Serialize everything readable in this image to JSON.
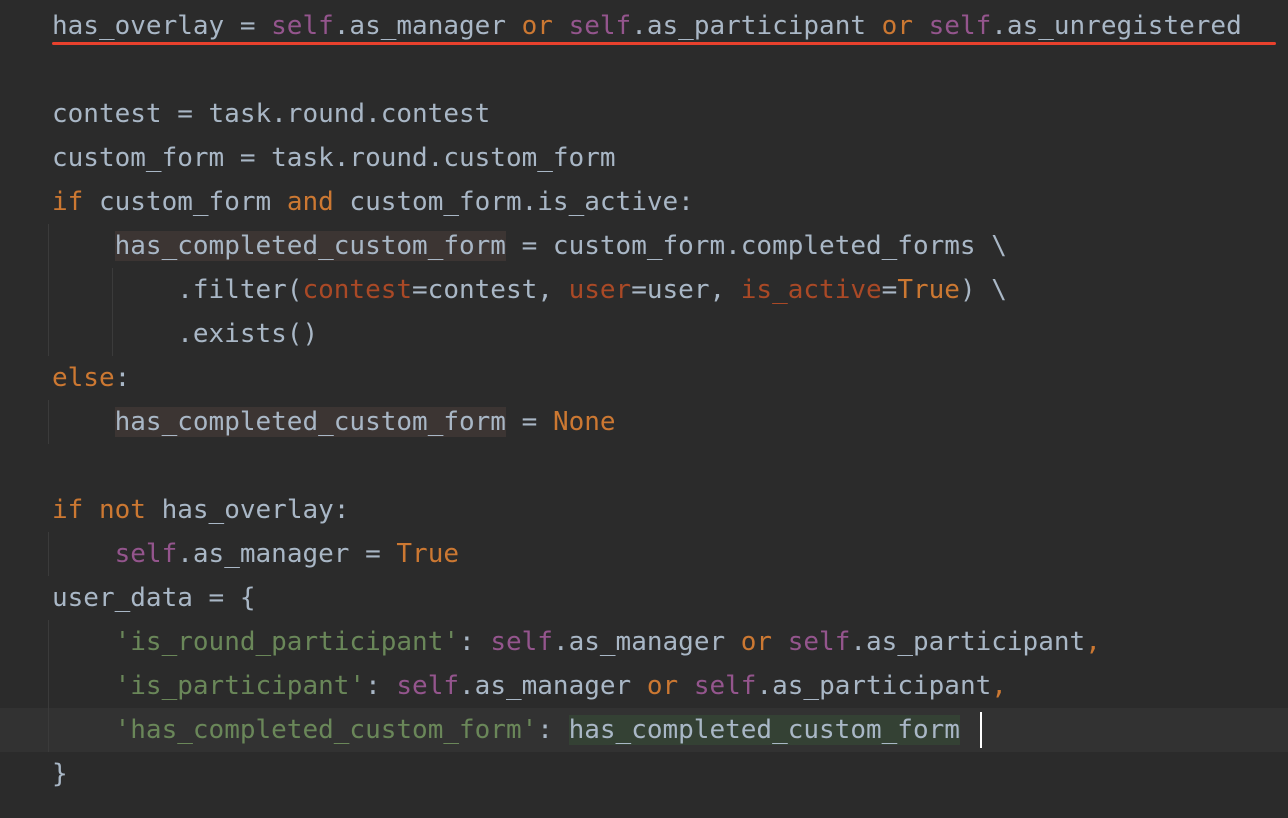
{
  "editor": {
    "language": "python",
    "colors": {
      "background": "#2b2b2b",
      "keyword": "#cc7832",
      "self": "#94558d",
      "string": "#6a8759",
      "param": "#aa4926",
      "text": "#a9b7c6",
      "error_underline": "#e8412d"
    },
    "lines": [
      [
        "has_overlay",
        " = ",
        "self",
        ".as_manager ",
        "or",
        " ",
        "self",
        ".as_participant ",
        "or",
        " ",
        "self",
        ".as_unregistered"
      ],
      [],
      [
        "contest = task.round.contest"
      ],
      [
        "custom_form = task.round.custom_form"
      ],
      [
        "if",
        " custom_form ",
        "and",
        " custom_form.is_active:"
      ],
      [
        "    ",
        "has_completed_custom_form",
        " = custom_form.completed_forms \\"
      ],
      [
        "        .filter(",
        "contest",
        "=contest, ",
        "user",
        "=user, ",
        "is_active",
        "=",
        "True",
        ") \\"
      ],
      [
        "        .exists()"
      ],
      [
        "else",
        ":"
      ],
      [
        "    ",
        "has_completed_custom_form",
        " = ",
        "None"
      ],
      [],
      [
        "if",
        " ",
        "not",
        " has_overlay:"
      ],
      [
        "    ",
        "self",
        ".as_manager = ",
        "True"
      ],
      [
        "user_data = {"
      ],
      [
        "    ",
        "'is_round_participant'",
        ": ",
        "self",
        ".as_manager ",
        "or",
        " ",
        "self",
        ".as_participant",
        ","
      ],
      [
        "    ",
        "'is_participant'",
        ": ",
        "self",
        ".as_manager ",
        "or",
        " ",
        "self",
        ".as_participant",
        ","
      ],
      [
        "    ",
        "'has_completed_custom_form'",
        ": ",
        "has_completed_custom_form"
      ],
      [
        "}"
      ]
    ]
  }
}
